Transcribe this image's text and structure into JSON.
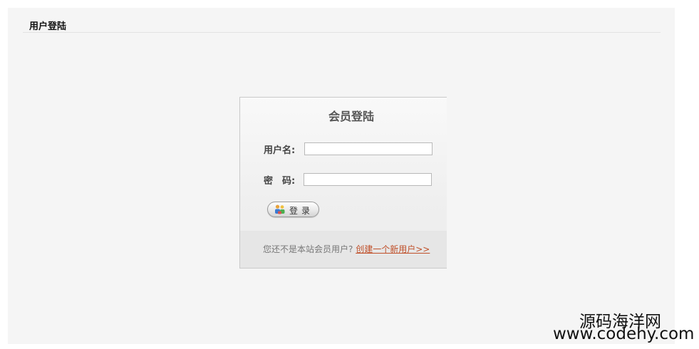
{
  "header": {
    "title": "用户登陆"
  },
  "login_box": {
    "title": "会员登陆",
    "username_label": "用户名:",
    "username_value": "",
    "password_label": "密　码:",
    "password_value": "",
    "login_button_label": "登录",
    "login_button_icon": "users-icon"
  },
  "footer": {
    "prompt": "您还不是本站会员用户?",
    "register_link": "创建一个新用户>>"
  },
  "watermark": {
    "site_name": "源码海洋网",
    "url": "www.codehy.com"
  },
  "colors": {
    "panel_bg": "#f5f5f5",
    "link": "#c0502a",
    "footer_band": "#e6e6e6"
  }
}
